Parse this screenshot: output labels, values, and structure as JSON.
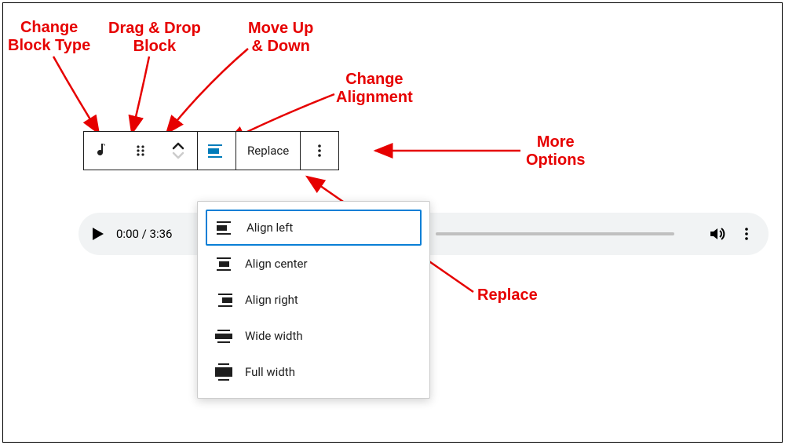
{
  "annotations": {
    "change_block_type": "Change\nBlock Type",
    "drag_drop": "Drag & Drop\nBlock",
    "move_updown": "Move Up\n& Down",
    "change_alignment": "Change\nAlignment",
    "more_options": "More\nOptions",
    "replace": "Replace"
  },
  "toolbar": {
    "replace_label": "Replace"
  },
  "audio": {
    "time": "0:00 / 3:36"
  },
  "dropdown": {
    "items": [
      {
        "label": "Align left"
      },
      {
        "label": "Align center"
      },
      {
        "label": "Align right"
      },
      {
        "label": "Wide width"
      },
      {
        "label": "Full width"
      }
    ]
  },
  "colors": {
    "accent": "#007cba",
    "annotation": "#e60000"
  }
}
